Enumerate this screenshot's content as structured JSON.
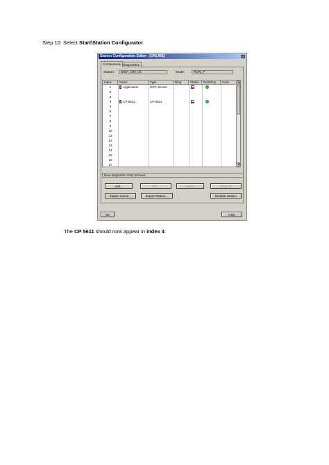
{
  "step_line": {
    "prefix": "Step 10: Select ",
    "bold": "Start\\Station Configurator",
    "suffix": "."
  },
  "window": {
    "title": "Station Configuration Editor - [ONLINE]",
    "close": "x",
    "tabs": [
      "Components",
      "Diagnostics"
    ],
    "station_label": "Station:",
    "station_value": "DISA_OM_01",
    "mode_label": "Mode:",
    "mode_value": "RUN_P",
    "columns": [
      "Index",
      "Name",
      "Type",
      "Ring",
      "Status",
      "Run/Stop",
      "Conn"
    ],
    "rows": [
      {
        "index": "1",
        "name": "Application",
        "type": "OPC Server",
        "icon": "application-icon",
        "status": "status-icon",
        "run": "run-check-icon"
      },
      {
        "index": "2",
        "name": "",
        "type": ""
      },
      {
        "index": "3",
        "name": "",
        "type": ""
      },
      {
        "index": "4",
        "name": "CP 5611",
        "type": "CP 5611",
        "icon": "cp-icon",
        "status": "status-icon",
        "run": "run-check-icon"
      },
      {
        "index": "5",
        "name": "",
        "type": ""
      },
      {
        "index": "6",
        "name": "",
        "type": ""
      },
      {
        "index": "7",
        "name": "",
        "type": ""
      },
      {
        "index": "8",
        "name": "",
        "type": ""
      },
      {
        "index": "9",
        "name": "",
        "type": ""
      },
      {
        "index": "10",
        "name": "",
        "type": ""
      },
      {
        "index": "11",
        "name": "",
        "type": ""
      },
      {
        "index": "12",
        "name": "",
        "type": ""
      },
      {
        "index": "13",
        "name": "",
        "type": ""
      },
      {
        "index": "14",
        "name": "",
        "type": ""
      },
      {
        "index": "15",
        "name": "",
        "type": ""
      },
      {
        "index": "16",
        "name": "",
        "type": ""
      },
      {
        "index": "17",
        "name": "",
        "type": ""
      }
    ],
    "status_message": "New diagnostic entry arrived!",
    "buttons": {
      "add": "Add...",
      "edit": "Edit...",
      "delete": "Delete",
      "ring_on": "Ring ON",
      "station_name": "Station Name...",
      "import_station": "Import Station...",
      "disable_station": "Disable Station",
      "ok": "OK",
      "help": "Help"
    },
    "colors": {
      "title_start": "#0a246a",
      "title_end": "#a6caf0",
      "face": "#d4d0c8"
    }
  },
  "after_line": {
    "p1": "The ",
    "b1": "CP 5611",
    "p2": " should now appear in ",
    "b2": "index 4",
    "p3": "."
  }
}
